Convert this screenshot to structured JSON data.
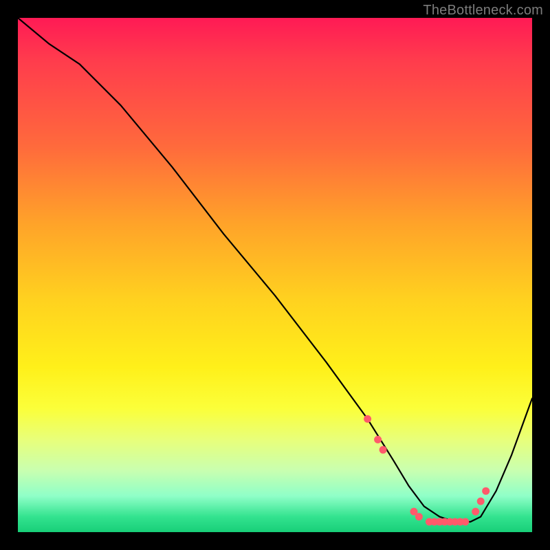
{
  "attribution": "TheBottleneck.com",
  "chart_data": {
    "type": "line",
    "title": "",
    "xlabel": "",
    "ylabel": "",
    "xlim": [
      0,
      100
    ],
    "ylim": [
      0,
      100
    ],
    "series": [
      {
        "name": "curve",
        "x": [
          0,
          6,
          12,
          20,
          30,
          40,
          50,
          60,
          68,
          73,
          76,
          79,
          82,
          85,
          88,
          90,
          93,
          96,
          100
        ],
        "y": [
          100,
          95,
          91,
          83,
          71,
          58,
          46,
          33,
          22,
          14,
          9,
          5,
          3,
          2,
          2,
          3,
          8,
          15,
          26
        ]
      }
    ],
    "markers": {
      "name": "highlight-points",
      "color": "#ff5a6b",
      "x": [
        68,
        70,
        71,
        77,
        78,
        80,
        81,
        82,
        83,
        84,
        85,
        86,
        87,
        89,
        90,
        91
      ],
      "y": [
        22,
        18,
        16,
        4,
        3,
        2,
        2,
        2,
        2,
        2,
        2,
        2,
        2,
        4,
        6,
        8
      ]
    }
  }
}
